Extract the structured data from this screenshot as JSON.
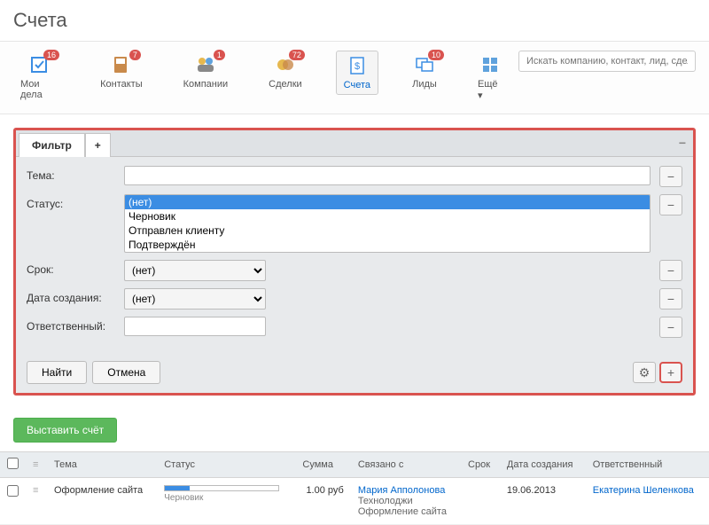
{
  "page_title": "Счета",
  "nav": [
    {
      "label": "Мои дела",
      "badge": "16"
    },
    {
      "label": "Контакты",
      "badge": "7"
    },
    {
      "label": "Компании",
      "badge": "1"
    },
    {
      "label": "Сделки",
      "badge": "72"
    },
    {
      "label": "Счета",
      "badge": ""
    },
    {
      "label": "Лиды",
      "badge": "10"
    }
  ],
  "nav_more": "Ещё ▾",
  "search_placeholder": "Искать компанию, контакт, лид, сделку",
  "filter": {
    "tab_label": "Фильтр",
    "fields": {
      "theme_label": "Тема:",
      "status_label": "Статус:",
      "status_options": [
        "(нет)",
        "Черновик",
        "Отправлен клиенту",
        "Подтверждён"
      ],
      "deadline_label": "Срок:",
      "deadline_value": "(нет)",
      "created_label": "Дата создания:",
      "created_value": "(нет)",
      "responsible_label": "Ответственный:"
    },
    "actions": {
      "find": "Найти",
      "cancel": "Отмена"
    }
  },
  "create_button": "Выставить счёт",
  "table": {
    "headers": {
      "theme": "Тема",
      "status": "Статус",
      "sum": "Сумма",
      "linked": "Связано с",
      "deadline": "Срок",
      "created": "Дата создания",
      "responsible": "Ответственный"
    },
    "rows": [
      {
        "theme": "Оформление сайта",
        "status_label": "Черновик",
        "progress_pct": 22,
        "sum": "1.00 руб",
        "linked_contact": "Мария Апполонова",
        "linked_company": "Технолоджи",
        "linked_item": "Оформление сайта",
        "deadline": "",
        "created": "19.06.2013",
        "responsible": "Екатерина Шеленкова"
      }
    ]
  }
}
